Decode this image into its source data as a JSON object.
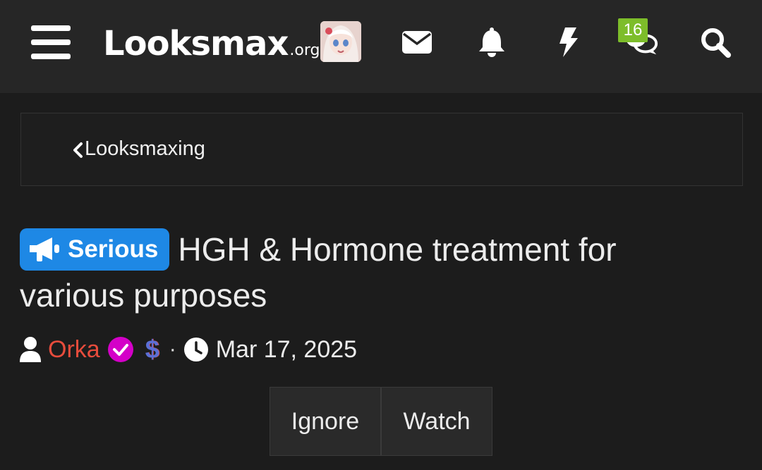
{
  "header": {
    "logo_main": "Looksmax",
    "logo_tld": ".org",
    "alerts_badge": "16",
    "icons": [
      "menu-icon",
      "envelope-icon",
      "bell-icon",
      "bolt-icon",
      "chat-icon",
      "search-icon"
    ]
  },
  "breadcrumb": {
    "label": "Looksmaxing"
  },
  "thread": {
    "prefix": "Serious",
    "title_line1": "HGH & Hormone treatment for",
    "title_line2": "various purposes",
    "author": "Orka",
    "separator": "·",
    "dollar_symbol": "$",
    "date": "Mar 17, 2025"
  },
  "actions": {
    "ignore": "Ignore",
    "watch": "Watch"
  },
  "colors": {
    "header_bg": "#262626",
    "page_bg": "#1c1c1c",
    "prefix_bg": "#1e88e5",
    "badge_bg": "#7dbd2a",
    "author": "#e74c3c",
    "verified": "#d400c8"
  }
}
